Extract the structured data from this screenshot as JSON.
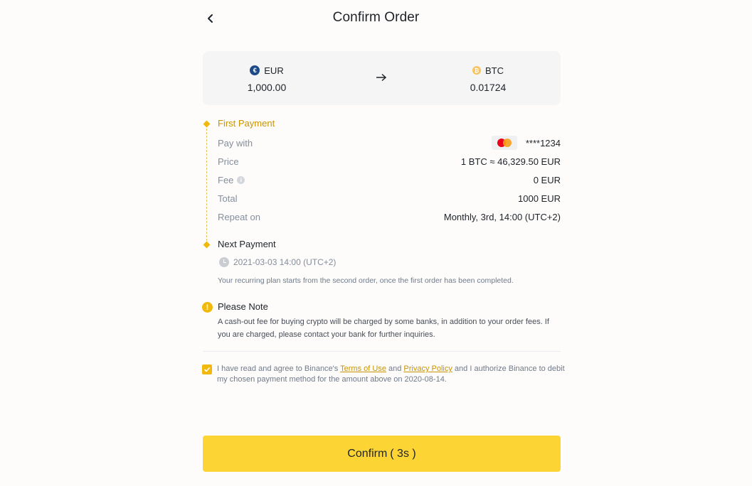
{
  "header": {
    "title": "Confirm Order",
    "back_icon": "chevron-left-icon"
  },
  "conversion": {
    "from": {
      "currency": "EUR",
      "amount": "1,000.00",
      "icon": "euro-coin-icon",
      "icon_glyph": "€",
      "icon_color": "#1f4a8a"
    },
    "to": {
      "currency": "BTC",
      "amount": "0.01724",
      "icon": "bitcoin-coin-icon",
      "icon_glyph": "₿",
      "icon_color": "#f7c35f"
    },
    "arrow_icon": "arrow-right-icon"
  },
  "first_payment": {
    "title": "First Payment",
    "rows": [
      {
        "label": "Pay with",
        "value": "****1234",
        "icon": "mastercard-icon"
      },
      {
        "label": "Price",
        "value": "1 BTC ≈ 46,329.50 EUR"
      },
      {
        "label": "Fee",
        "value": "0 EUR",
        "label_icon": "info-icon"
      },
      {
        "label": "Total",
        "value": "1000 EUR"
      },
      {
        "label": "Repeat on",
        "value": "Monthly, 3rd, 14:00 (UTC+2)"
      }
    ]
  },
  "next_payment": {
    "title": "Next Payment",
    "datetime": "2021-03-03 14:00 (UTC+2)",
    "note": "Your recurring plan starts from the second order, once the first order has been completed."
  },
  "please_note": {
    "title": "Please Note",
    "text": "A cash-out fee for buying crypto will be charged by some banks, in addition to your order fees. If you are charged, please contact your bank for further inquiries."
  },
  "agreement": {
    "checked": true,
    "text_before": "I have read and agree to Binance's ",
    "terms_link": "Terms of Use",
    "text_and": " and ",
    "privacy_link": "Privacy Policy",
    "text_after": " and I authorize Binance to debit my chosen payment method for the amount above on 2020-08-14."
  },
  "confirm_button": {
    "label": "Confirm",
    "countdown": "( 3s )"
  },
  "colors": {
    "accent": "#f0b90b",
    "button": "#fcd535",
    "link": "#c99400",
    "muted_text": "#848e9c",
    "text": "#1e2329"
  }
}
